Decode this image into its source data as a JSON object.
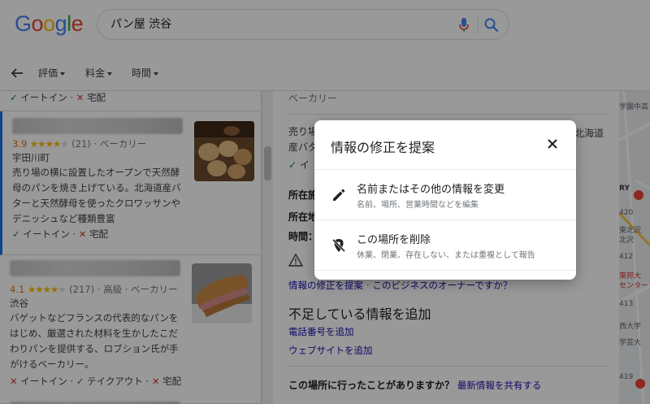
{
  "header": {
    "logo": "Google",
    "search_value": "パン屋 渋谷",
    "filters": [
      "評価",
      "料金",
      "時間"
    ]
  },
  "list": {
    "top_attrs": {
      "dine_in": "イートイン",
      "delivery": "宅配"
    },
    "cards": [
      {
        "rating": "3.9",
        "stars": "★★★★",
        "stars_empty": "★",
        "reviews": "(21)",
        "category": "ベーカリー",
        "location": "宇田川町",
        "description": "売り場の横に設置したオープンで天然酵母のパンを焼き上げている。北海道産バターと天然酵母を使ったクロワッサンやデニッシュなど種類豊富",
        "attr1": "イートイン",
        "attr2": "宅配"
      },
      {
        "rating": "4.1",
        "stars": "★★★★",
        "stars_empty": "★",
        "reviews": "(217)",
        "price": "高級",
        "category": "ベーカリー",
        "location": "渋谷",
        "description": "バゲットなどフランスの代表的なパンをはじめ、厳選された材料を生かしたこだわりパンを提供する、ロブション氏が手がけるベーカリー。",
        "attr1": "イートイン",
        "attr2": "テイクアウト",
        "attr3": "宅配"
      }
    ]
  },
  "detail": {
    "category": "ベーカリー",
    "desc_line1": "売り場",
    "desc_line1_end": "北海道",
    "desc_line2": "産バタ",
    "check_text": "イ",
    "label_address1": "所在施",
    "label_address2": "所在地",
    "label_hours": "時間：",
    "suggest_link": "情報の修正を提案",
    "owner_link": "このビジネスのオーナーですか？",
    "missing_heading": "不足している情報を追加",
    "add_phone": "電話番号を追加",
    "add_website": "ウェブサイトを追加",
    "visited_question": "この場所に行ったことがありますか？",
    "share_link": "最新情報を共有する"
  },
  "map": {
    "labels": [
      "学園中高",
      "RY",
      "420",
      "東北沢",
      "北沢",
      "412",
      "東邦大",
      "センター",
      "413",
      "西大学",
      "学芸大",
      "419"
    ]
  },
  "dialog": {
    "title": "情報の修正を提案",
    "options": [
      {
        "title": "名前またはその他の情報を変更",
        "subtitle": "名前、場所、営業時間などを編集"
      },
      {
        "title": "この場所を削除",
        "subtitle": "休業、閉業、存在しない、または重複として報告"
      }
    ]
  }
}
